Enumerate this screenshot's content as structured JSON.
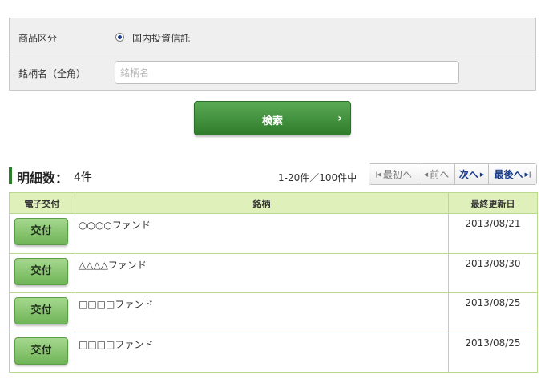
{
  "search_form": {
    "category_label": "商品区分",
    "category_option": "国内投資信託",
    "category_selected": true,
    "fund_name_label": "銘柄名（全角）",
    "fund_name_placeholder": "銘柄名",
    "fund_name_value": "",
    "search_button_label": "検索"
  },
  "summary": {
    "count_label": "明細数：",
    "count_value": "4件",
    "range_text": "1-20件／100件中"
  },
  "pager": {
    "first_label": "最初へ",
    "prev_label": "前へ",
    "next_label": "次へ",
    "last_label": "最後へ"
  },
  "table": {
    "headers": [
      "電子交付",
      "銘柄",
      "最終更新日"
    ],
    "rows": [
      {
        "button_label": "交付",
        "name": "○○○○ファンド",
        "date": "2013/08/21"
      },
      {
        "button_label": "交付",
        "name": "△△△△ファンド",
        "date": "2013/08/30"
      },
      {
        "button_label": "交付",
        "name": "□□□□ファンド",
        "date": "2013/08/25"
      },
      {
        "button_label": "交付",
        "name": "□□□□ファンド",
        "date": "2013/08/25"
      }
    ]
  }
}
